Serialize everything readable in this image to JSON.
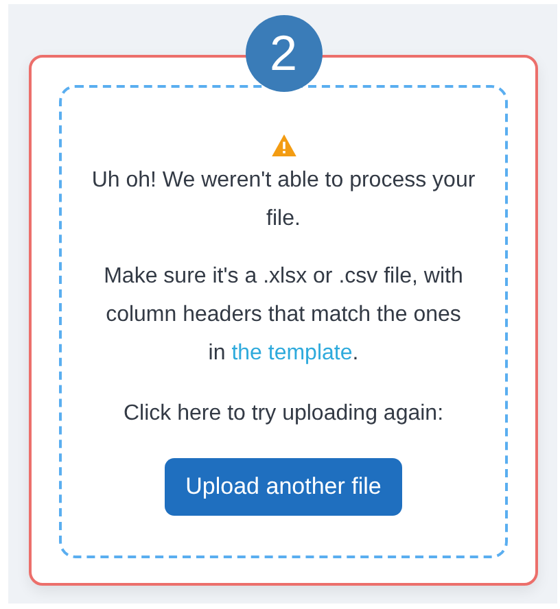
{
  "step": {
    "number": "2",
    "failed": true
  },
  "error": {
    "title": "Uh oh! We weren't able to process your file.",
    "hint_before": "Make sure it's a .xlsx or .csv file, with column headers that match the ones in ",
    "hint_link": "the template",
    "hint_after": ".",
    "retry_prompt": "Click here to try uploading again:",
    "button": "Upload another file"
  }
}
